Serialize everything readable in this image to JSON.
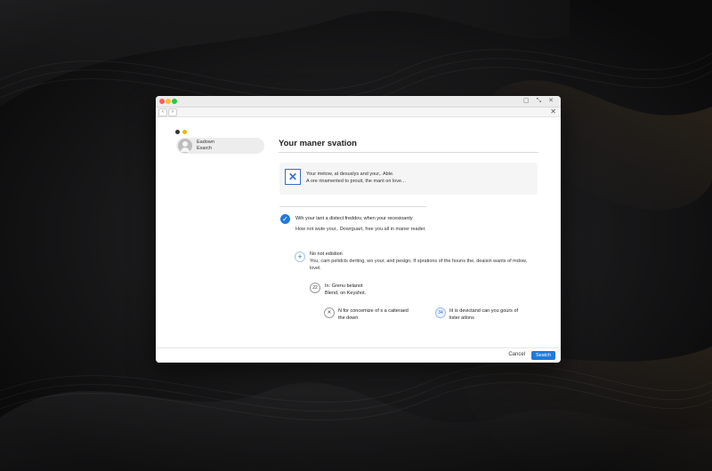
{
  "window": {
    "toolbar": {
      "back_icon": "‹",
      "forward_icon": "›",
      "close_icon": "✕",
      "window_icons": "▢ ⤡ ✕"
    },
    "colors": {
      "accent": "#1f7bdc",
      "traffic_red": "#ff5f57",
      "traffic_yellow": "#febc2e",
      "traffic_green": "#28c840"
    }
  },
  "sidebar": {
    "account": {
      "name": "Eadown",
      "subtitle": "Exarch"
    }
  },
  "main": {
    "title": "Your maner svation",
    "info_card": {
      "icon": "close-icon",
      "line1": "Your metow, at desuslys and your,. Able.",
      "line2": "A ore rinamented to prouit, the mant on love…"
    },
    "selected_option": {
      "icon": "check-icon",
      "line1": "Wih your lant a distect freddov, when your recesioanty",
      "line2": "How not wute your,. Dowrguart, free you all in maner reader."
    },
    "option": {
      "icon": "plus-icon",
      "title": "No not edistion",
      "description": "You, cam pelidcts derting, wo your, and pesign, If sprations of the houns the, deaisin wants of mdow, lovel."
    },
    "sub_option": {
      "badge": "22",
      "line1": "In: Grenu belanot",
      "line2": "Blend, on Keyshot."
    },
    "items": [
      {
        "badge": "✕",
        "line1": "N for concemize of s a caiteraed",
        "line2": "the down"
      },
      {
        "badge": "34",
        "line1": "Iit is devictand can you gours of",
        "line2": "lister atlons"
      }
    ]
  },
  "footer": {
    "cancel_label": "Cancel",
    "primary_label": "Seatch"
  }
}
